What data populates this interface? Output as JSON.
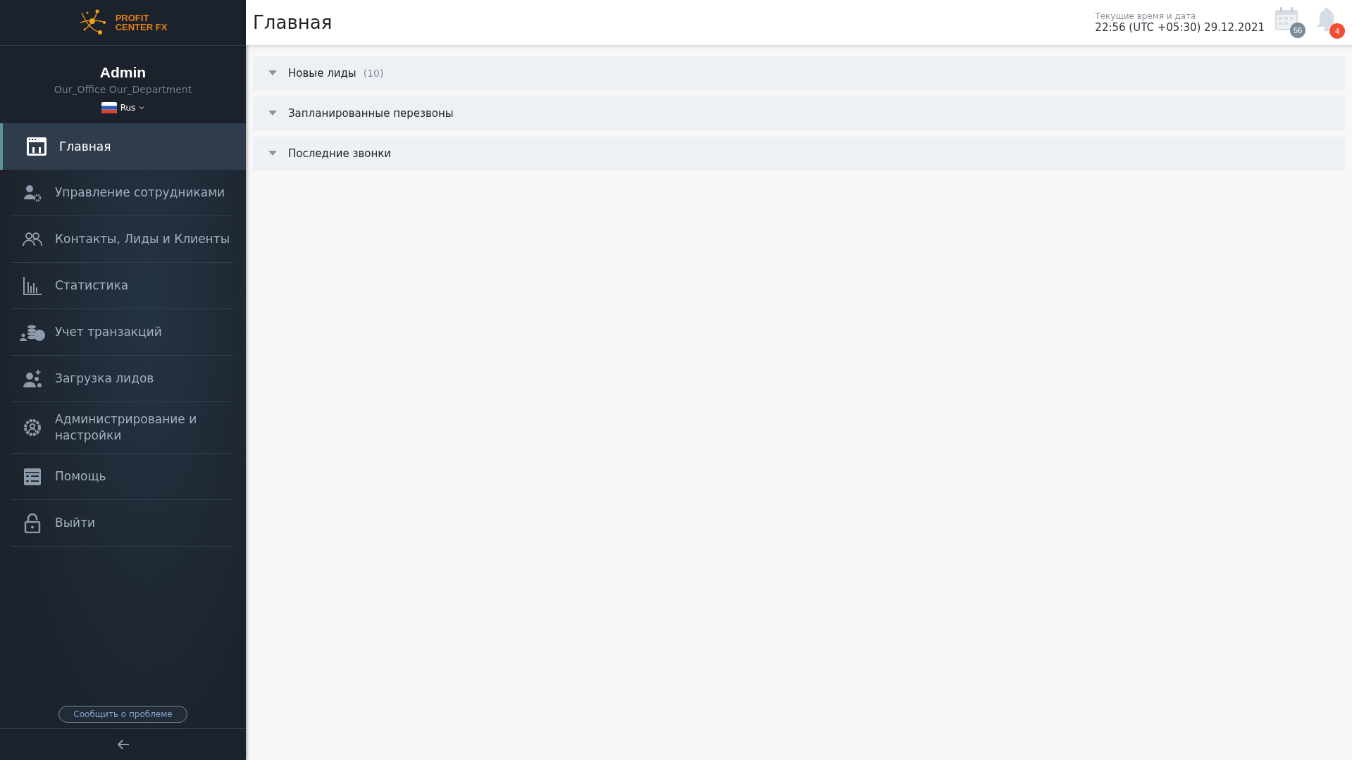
{
  "logo": {
    "line1": "PROFIT",
    "line2": "CENTER FX"
  },
  "user": {
    "name": "Admin",
    "office": "Our_Office Our_Department",
    "language": "Rus"
  },
  "nav": [
    {
      "kind": "home",
      "label": "Главная",
      "selected": true
    },
    {
      "kind": "staff",
      "label": "Управление сотрудниками",
      "selected": false
    },
    {
      "kind": "contacts",
      "label": "Контакты, Лиды и Клиенты",
      "selected": false
    },
    {
      "kind": "stats",
      "label": "Статистика",
      "selected": false
    },
    {
      "kind": "transactions",
      "label": "Учет транзакций",
      "selected": false
    },
    {
      "kind": "upload",
      "label": "Загрузка лидов",
      "selected": false
    },
    {
      "kind": "admin",
      "label": "Администрирование и настройки",
      "selected": false
    },
    {
      "kind": "help",
      "label": "Помощь",
      "selected": false
    },
    {
      "kind": "logout",
      "label": "Выйти",
      "selected": false
    }
  ],
  "report_button": "Сообщить о проблеме",
  "header": {
    "title": "Главная",
    "datetime_label": "Текущие время и дата",
    "datetime": "22:56 (UTC +05:30) 29.12.2021",
    "calendar_badge": "56",
    "notifications_badge": "4"
  },
  "sections": [
    {
      "title": "Новые лиды",
      "count": "(10)",
      "expanded": false
    },
    {
      "title": "Запланированные перезвоны",
      "expanded": false
    },
    {
      "title": "Последние звонки",
      "expanded": false
    }
  ]
}
